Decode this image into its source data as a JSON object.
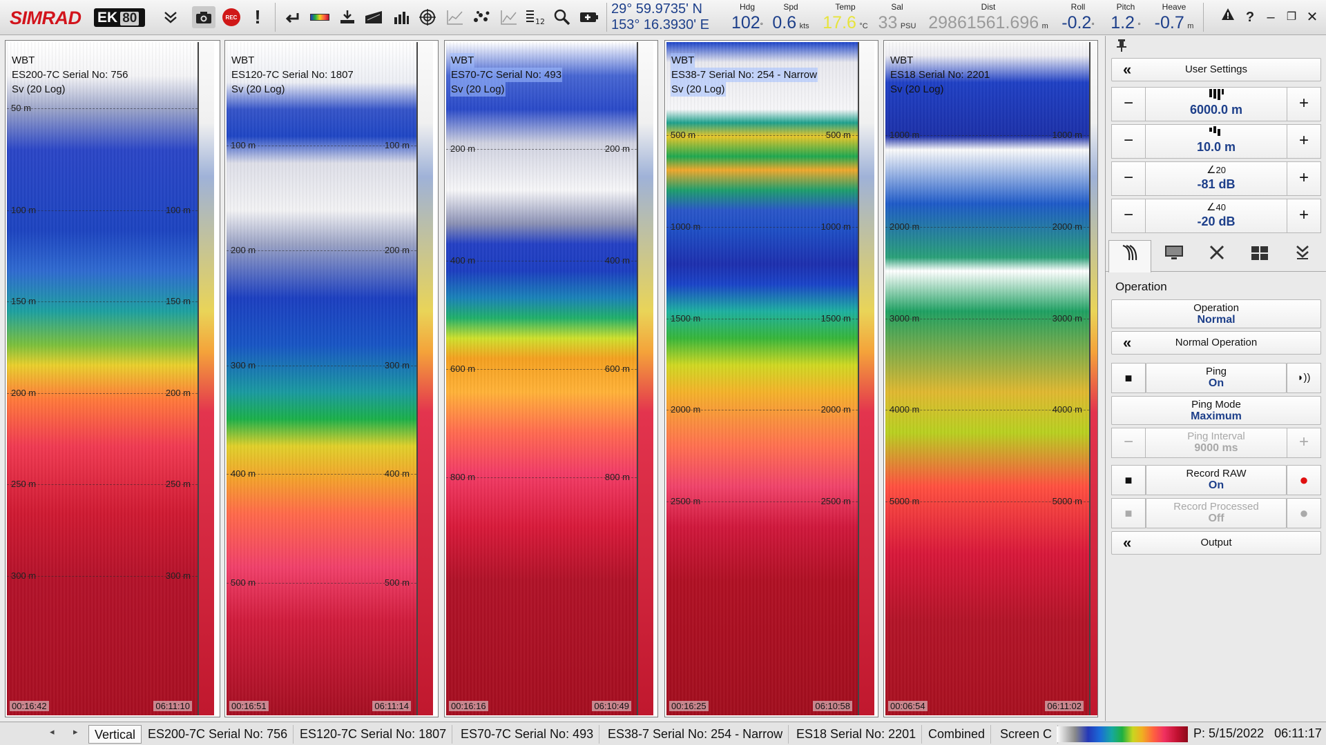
{
  "app": {
    "brand": "SIMRAD",
    "model": "EK",
    "model_num": "80"
  },
  "toolbar": {
    "buttons": [
      "expand-icon",
      "camera-icon",
      "record-icon",
      "alarm-icon",
      "undo-icon",
      "color-scale-icon",
      "depth-icon",
      "bottom-icon",
      "histogram-icon",
      "target-icon",
      "chart-icon",
      "scatter-icon",
      "trend-icon",
      "numeric-icon",
      "zoom-icon",
      "battery-icon"
    ],
    "rec_label": "REC"
  },
  "nav": {
    "lat": "29° 59.9735' N",
    "lon": "153° 16.3930' E",
    "hdg": {
      "label": "Hdg",
      "value": "102",
      "unit": "°"
    },
    "spd": {
      "label": "Spd",
      "value": "0.6",
      "unit": "kts"
    },
    "temp": {
      "label": "Temp",
      "value": "17.6",
      "unit": "°C"
    },
    "sal": {
      "label": "Sal",
      "value": "33",
      "unit": "PSU"
    },
    "dist": {
      "label": "Dist",
      "value": "29861561.696",
      "unit": "m"
    },
    "roll": {
      "label": "Roll",
      "value": "-0.2",
      "unit": "°"
    },
    "pitch": {
      "label": "Pitch",
      "value": "1.2",
      "unit": "°"
    },
    "heave": {
      "label": "Heave",
      "value": "-0.7",
      "unit": "m"
    }
  },
  "echograms": [
    {
      "line1": "WBT",
      "line2": "ES200-7C Serial No: 756",
      "line3": "Sv (20 Log)",
      "depths": [
        "50 m",
        "100 m",
        "150 m",
        "200 m",
        "250 m",
        "300 m"
      ],
      "depths_right": [
        "",
        "100 m",
        "150 m",
        "200 m",
        "250 m",
        "300 m"
      ],
      "time_left": "00:16:42",
      "time_right": "06:11:10"
    },
    {
      "line1": "WBT",
      "line2": "ES120-7C Serial No: 1807",
      "line3": "Sv (20 Log)",
      "depths": [
        "100 m",
        "200 m",
        "300 m",
        "400 m",
        "500 m"
      ],
      "depths_right": [
        "100 m",
        "200 m",
        "300 m",
        "400 m",
        "500 m"
      ],
      "time_left": "00:16:51",
      "time_right": "06:11:14"
    },
    {
      "line1": "WBT",
      "line2": "ES70-7C Serial No: 493",
      "line3": "Sv (20 Log)",
      "depths": [
        "200 m",
        "400 m",
        "600 m",
        "800 m"
      ],
      "depths_right": [
        "200 m",
        "400 m",
        "600 m",
        "800 m"
      ],
      "time_left": "00:16:16",
      "time_right": "06:10:49"
    },
    {
      "line1": "WBT",
      "line2": "ES38-7 Serial No: 254 - Narrow",
      "line3": "Sv (20 Log)",
      "depths": [
        "500 m",
        "1000 m",
        "1500 m",
        "2000 m",
        "2500 m"
      ],
      "depths_right": [
        "500 m",
        "1000 m",
        "1500 m",
        "2000 m",
        "2500 m"
      ],
      "time_left": "00:16:25",
      "time_right": "06:10:58"
    },
    {
      "line1": "WBT",
      "line2": "ES18 Serial No: 2201",
      "line3": "Sv (20 Log)",
      "depths": [
        "1000 m",
        "2000 m",
        "3000 m",
        "4000 m",
        "5000 m"
      ],
      "depths_right": [
        "1000 m",
        "2000 m",
        "3000 m",
        "4000 m",
        "5000 m"
      ],
      "time_left": "00:06:54",
      "time_right": "06:11:02"
    }
  ],
  "panel": {
    "user_settings": "User Settings",
    "range": "6000.0 m",
    "start_range": "10.0 m",
    "gain": {
      "top": "20",
      "value": "-81 dB"
    },
    "gain2": {
      "top": "40",
      "value": "-20 dB"
    },
    "tabs": [
      "sonar-icon",
      "monitor-icon",
      "tools-icon",
      "layout-icon",
      "install-icon"
    ],
    "section": "Operation",
    "operation": {
      "label": "Operation",
      "value": "Normal"
    },
    "normal_operation": "Normal Operation",
    "ping": {
      "label": "Ping",
      "value": "On"
    },
    "ping_mode": {
      "label": "Ping Mode",
      "value": "Maximum"
    },
    "ping_interval": {
      "label": "Ping Interval",
      "value": "9000 ms"
    },
    "record_raw": {
      "label": "Record RAW",
      "value": "On"
    },
    "record_processed": {
      "label": "Record Processed",
      "value": "Off"
    },
    "output": "Output",
    "minus": "−",
    "plus": "+"
  },
  "statusbar": {
    "tabs": [
      "Vertical",
      "ES200-7C Serial No: 756",
      "ES120-7C Serial No: 1807",
      "ES70-7C Serial No: 493",
      "ES38-7 Serial No: 254 - Narrow",
      "ES18 Serial No: 2201",
      "Combined",
      "Screen C"
    ],
    "playback": "P: 5/15/2022",
    "time": "06:11:17"
  },
  "colors": {
    "accent": "#1d3f8a",
    "rec": "#d01818",
    "warn": "#e7e43b"
  }
}
